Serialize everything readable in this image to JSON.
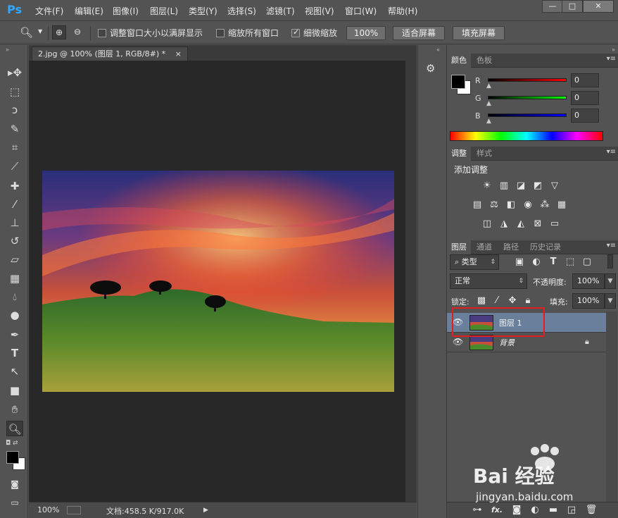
{
  "app": {
    "logo": "Ps"
  },
  "menu": [
    "文件(F)",
    "编辑(E)",
    "图像(I)",
    "图层(L)",
    "类型(Y)",
    "选择(S)",
    "滤镜(T)",
    "视图(V)",
    "窗口(W)",
    "帮助(H)"
  ],
  "window_controls": {
    "minimize": "—",
    "restore": "□",
    "close": "✕"
  },
  "options_bar": {
    "resize_windows": "调整窗口大小以满屏显示",
    "zoom_all": "缩放所有窗口",
    "scrubby_zoom": "细微缩放",
    "zoom_100": "100%",
    "fit_screen": "适合屏幕",
    "fill_screen": "填充屏幕"
  },
  "document": {
    "tab_title": "2.jpg @ 100% (图层 1, RGB/8#) *",
    "tab_close": "×",
    "zoom": "100%",
    "doc_info": "文档:458.5 K/917.0K"
  },
  "color_panel": {
    "tabs": [
      "颜色",
      "色板"
    ],
    "channels": [
      {
        "label": "R",
        "value": "0",
        "color": "#ff0000"
      },
      {
        "label": "G",
        "value": "0",
        "color": "#00ff00"
      },
      {
        "label": "B",
        "value": "0",
        "color": "#0000ff"
      }
    ]
  },
  "adjust_panel": {
    "tabs": [
      "调整",
      "样式"
    ],
    "title": "添加调整"
  },
  "layers_panel": {
    "tabs": [
      "图层",
      "通道",
      "路径",
      "历史记录"
    ],
    "filter_type": "类型",
    "blend_mode": "正常",
    "opacity_label": "不透明度:",
    "opacity_value": "100%",
    "lock_label": "锁定:",
    "fill_label": "填充:",
    "fill_value": "100%",
    "layers": [
      {
        "name": "图层 1",
        "selected": true
      },
      {
        "name": "背景",
        "selected": false
      }
    ],
    "footer_icons": [
      "link-icon",
      "fx-icon",
      "mask-icon",
      "adjustment-icon",
      "folder-icon",
      "new-layer-icon",
      "trash-icon"
    ],
    "fx_label": "fx."
  },
  "watermark": {
    "brand": "Bai 经验",
    "url": "jingyan.baidu.com"
  },
  "colors": {
    "highlight_box": "#e02020",
    "selected_layer": "#6a7f9c"
  }
}
